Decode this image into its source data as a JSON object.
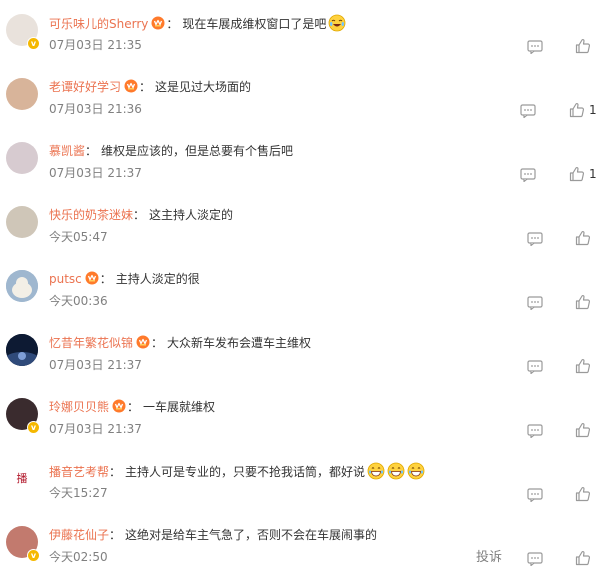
{
  "comments": [
    {
      "user": "可乐味儿的Sherry",
      "vip": true,
      "text": "现在车展成维权窗口了是吧",
      "emojis": [
        "laugh-cry-emoji"
      ],
      "time": "07月03日 21:35",
      "likes": "",
      "verified": true,
      "avatar_color": "#e9e2dc"
    },
    {
      "user": "老谭好好学习",
      "vip": true,
      "text": "这是见过大场面的",
      "emojis": [],
      "time": "07月03日 21:36",
      "likes": "1",
      "verified": false,
      "avatar_color": "#d8b49a"
    },
    {
      "user": "慕凯酱",
      "vip": false,
      "text": "维权是应该的，但是总要有个售后吧",
      "emojis": [],
      "time": "07月03日 21:37",
      "likes": "1",
      "verified": false,
      "avatar_color": "#d7cbd0"
    },
    {
      "user": "快乐的奶茶迷妹",
      "vip": false,
      "text": "这主持人淡定的",
      "emojis": [],
      "time": "今天05:47",
      "likes": "",
      "verified": false,
      "avatar_color": "#cfc6b8"
    },
    {
      "user": "putsc",
      "vip": true,
      "text": "主持人淡定的很",
      "emojis": [],
      "time": "今天00:36",
      "likes": "",
      "verified": false,
      "avatar_color": "#9fb7cf"
    },
    {
      "user": "忆昔年繁花似锦",
      "vip": true,
      "text": "大众新车发布会遭车主维权",
      "emojis": [],
      "time": "07月03日 21:37",
      "likes": "",
      "verified": false,
      "avatar_color": "#1c2a44"
    },
    {
      "user": "玲娜贝贝熊",
      "vip": true,
      "text": "一车展就维权",
      "emojis": [],
      "time": "07月03日 21:37",
      "likes": "",
      "verified": true,
      "avatar_color": "#3a2b2e"
    },
    {
      "user": "播音艺考帮",
      "vip": false,
      "text": "主持人可是专业的，只要不抢我话筒，都好说",
      "emojis": [
        "grin-emoji",
        "grin-emoji",
        "grin-emoji"
      ],
      "time": "今天15:27",
      "likes": "",
      "verified": false,
      "avatar_color": "#ffffff"
    },
    {
      "user": "伊藤花仙子",
      "vip": false,
      "text": "这绝对是给车主气急了，否则不会在车展闹事的",
      "emojis": [],
      "time": "今天02:50",
      "likes": "",
      "verified": true,
      "avatar_color": "#c27a6e",
      "report": "投诉"
    }
  ],
  "icons": {
    "reply": "comment-bubble-icon",
    "like": "thumbs-up-icon",
    "vip": "vip-crown-badge-icon"
  },
  "colors": {
    "username": "#eb7350",
    "meta": "#808080",
    "vip_badge": "#f5b800"
  }
}
